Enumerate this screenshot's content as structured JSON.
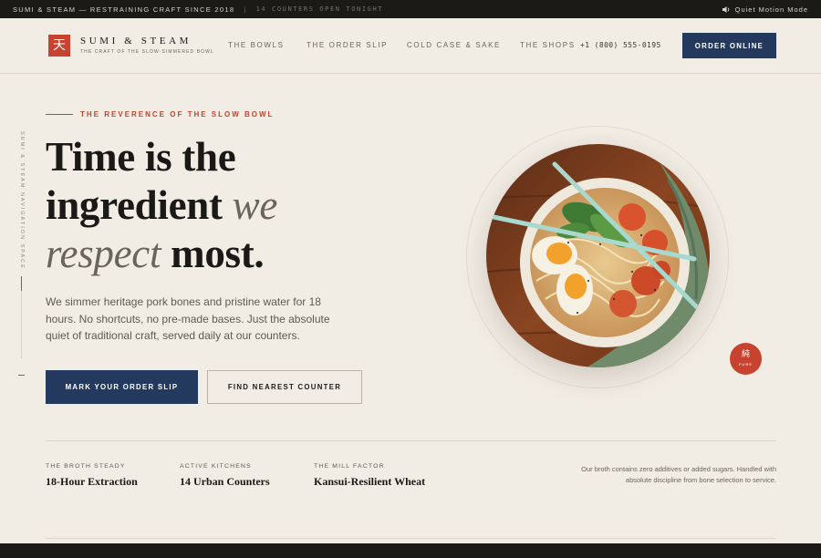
{
  "topbar": {
    "tagline": "SUMI & STEAM — RESTRAINING CRAFT SINCE 2018",
    "divider": "|",
    "counters": "14 COUNTERS OPEN TONIGHT",
    "motion_label": "Quiet Motion Mode"
  },
  "header": {
    "logo_glyph": "天",
    "brand": "SUMI & STEAM",
    "brand_sub": "THE CRAFT OF THE SLOW-SIMMERED BOWL",
    "nav": [
      "THE BOWLS",
      "THE ORDER SLIP",
      "COLD CASE & SAKE",
      "THE SHOPS"
    ],
    "phone": "+1 (800) 555-0195",
    "order_button": "ORDER ONLINE"
  },
  "sidebar": {
    "vertical_label": "SUMI & STEAM NAVIGATION SPACE"
  },
  "hero": {
    "eyebrow": "THE REVERENCE OF THE SLOW BOWL",
    "headline": {
      "line1": "Time is the",
      "line2_a": "ingredient",
      "line2_b": "we",
      "line3_a": "respect",
      "line3_b": "most."
    },
    "body": "We simmer heritage pork bones and pristine water for 18 hours. No shortcuts, no pre-made bases. Just the absolute quiet of traditional craft, served daily at our counters.",
    "primary_button": "MARK YOUR ORDER SLIP",
    "secondary_button": "FIND NEAREST COUNTER",
    "badge_glyph": "純",
    "badge_word": "PURE"
  },
  "stats": [
    {
      "label": "THE BROTH STEADY",
      "value": "18-Hour Extraction"
    },
    {
      "label": "ACTIVE KITCHENS",
      "value": "14 Urban Counters"
    },
    {
      "label": "THE MILL FACTOR",
      "value": "Kansui-Resilient Wheat"
    }
  ],
  "disclaimer": "Our broth contains zero additives or added sugars. Handled with absolute discipline from bone selection to service.",
  "colors": {
    "accent": "#c8432f",
    "navy": "#24395e",
    "background": "#f1ece4",
    "dark": "#1b1a17"
  }
}
